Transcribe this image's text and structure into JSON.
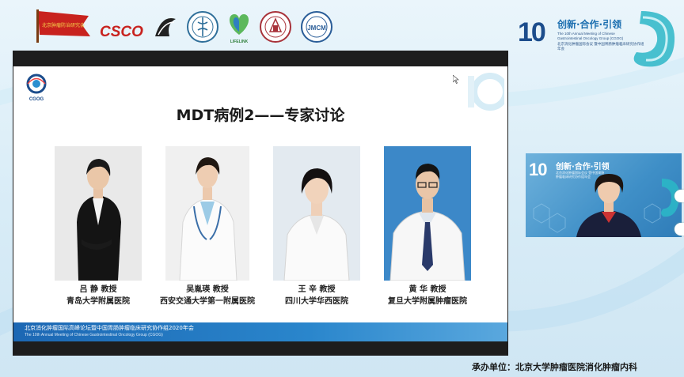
{
  "top_logos": {
    "flag_text": "北京肿瘤防治研究会",
    "csco_text": "CSCO",
    "round_logo_2_text": "JMCM",
    "lifelink_text": "LIFELINK"
  },
  "anniversary": {
    "number": "10",
    "slogan": "创新·合作·引领",
    "en": "The 10th Annual Meeting of Chinese Gastrointestinal Oncology Group (CGOG)",
    "cn": "北京消化肿瘤国际会议 暨中国胃肠肿瘤临床研究协作组年会"
  },
  "slide": {
    "logo_text": "CGOG",
    "title": "MDT病例2——专家讨论",
    "experts": [
      {
        "name": "吕 静  教授",
        "hospital": "青岛大学附属医院"
      },
      {
        "name": "吴胤瑛  教授",
        "hospital": "西安交通大学第一附属医院"
      },
      {
        "name": "王 辛  教授",
        "hospital": "四川大学华西医院"
      },
      {
        "name": "黄 华  教授",
        "hospital": "复旦大学附属肿瘤医院"
      }
    ],
    "footer_cn": "北京消化肿瘤国际高峰论坛暨中国胃肠肿瘤临床研究协作组2020年会",
    "footer_en": "The 10th Annual Meeting of Chinese Gastrointestinal Oncology Group (CGOG)"
  },
  "video": {
    "number": "10",
    "slogan": "创新·合作·引领",
    "sub": "北京消化肿瘤国际会议 暨中国胃肠肿瘤临床研究协作组年会"
  },
  "organiser": "承办单位：北京大学肿瘤医院消化肿瘤内科",
  "colors": {
    "brand_blue": "#1c4d8c",
    "footer_blue": "#1c67b3",
    "flag_red": "#c8221e"
  }
}
